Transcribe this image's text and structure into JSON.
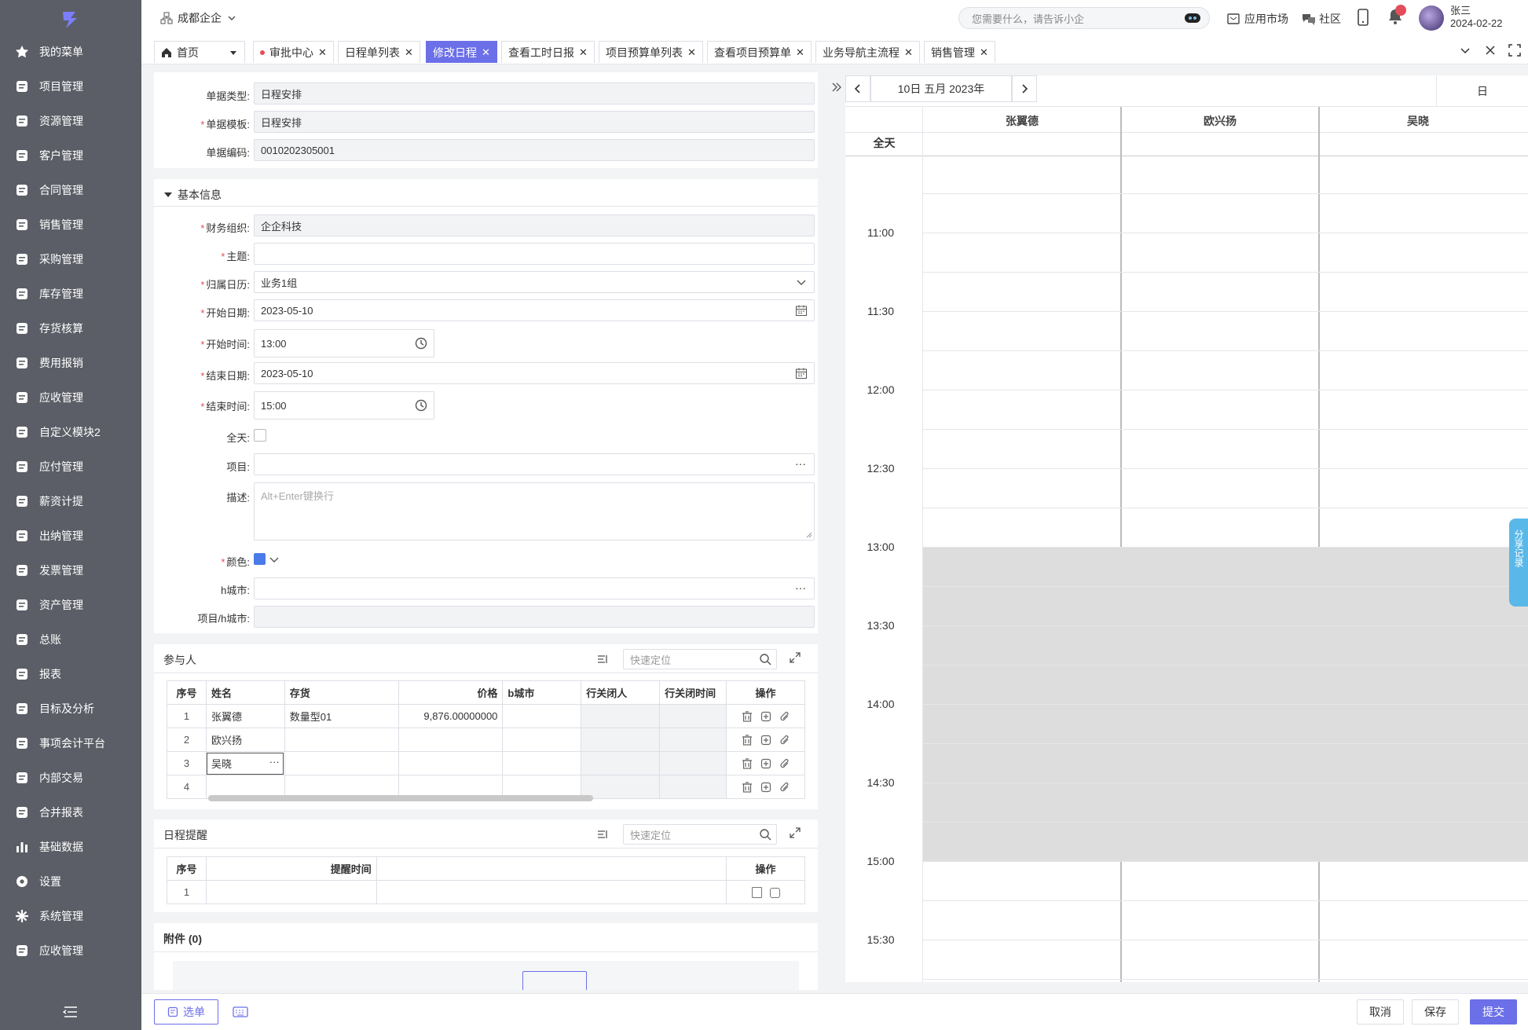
{
  "sidebar": {
    "items": [
      {
        "label": "我的菜单",
        "icon": "star-icon"
      },
      {
        "label": "项目管理",
        "icon": "project-icon"
      },
      {
        "label": "资源管理",
        "icon": "layers-icon"
      },
      {
        "label": "客户管理",
        "icon": "customer-icon"
      },
      {
        "label": "合同管理",
        "icon": "contract-icon"
      },
      {
        "label": "销售管理",
        "icon": "sales-icon"
      },
      {
        "label": "采购管理",
        "icon": "cart-icon"
      },
      {
        "label": "库存管理",
        "icon": "warehouse-icon"
      },
      {
        "label": "存货核算",
        "icon": "inventory-icon"
      },
      {
        "label": "费用报销",
        "icon": "expense-icon"
      },
      {
        "label": "应收管理",
        "icon": "receivable-icon"
      },
      {
        "label": "自定义模块2",
        "icon": "chart-line-icon"
      },
      {
        "label": "应付管理",
        "icon": "payable-icon"
      },
      {
        "label": "薪资计提",
        "icon": "salary-icon"
      },
      {
        "label": "出纳管理",
        "icon": "cashier-icon"
      },
      {
        "label": "发票管理",
        "icon": "invoice-icon"
      },
      {
        "label": "资产管理",
        "icon": "asset-icon"
      },
      {
        "label": "总账",
        "icon": "ledger-icon"
      },
      {
        "label": "报表",
        "icon": "report-icon"
      },
      {
        "label": "目标及分析",
        "icon": "target-icon"
      },
      {
        "label": "事项会计平台",
        "icon": "grid-icon"
      },
      {
        "label": "内部交易",
        "icon": "exchange-icon"
      },
      {
        "label": "合并报表",
        "icon": "merge-report-icon"
      },
      {
        "label": "基础数据",
        "icon": "bar-chart-icon"
      },
      {
        "label": "设置",
        "icon": "gear-icon"
      },
      {
        "label": "系统管理",
        "icon": "system-icon"
      },
      {
        "label": "应收管理",
        "icon": "receivable-icon"
      }
    ]
  },
  "header": {
    "org": "成都企企",
    "search_placeholder": "您需要什么，请告诉小企",
    "app_market": "应用市场",
    "community": "社区",
    "user_name": "张三",
    "date": "2024-02-22"
  },
  "tabs": [
    {
      "label": "首页"
    },
    {
      "label": "审批中心"
    },
    {
      "label": "日程单列表"
    },
    {
      "label": "修改日程"
    },
    {
      "label": "查看工时日报"
    },
    {
      "label": "项目预算单列表"
    },
    {
      "label": "查看项目预算单"
    },
    {
      "label": "业务导航主流程"
    },
    {
      "label": "销售管理"
    }
  ],
  "form": {
    "doc_type_label": "单据类型:",
    "doc_type_value": "日程安排",
    "template_label": "单据模板:",
    "template_value": "日程安排",
    "code_label": "单据编码:",
    "code_value": "0010202305001",
    "section_basic": "基本信息",
    "org_label": "财务组织:",
    "org_value": "企企科技",
    "subject_label": "主题:",
    "subject_value": "",
    "calendar_label": "归属日历:",
    "calendar_value": "业务1组",
    "start_date_label": "开始日期:",
    "start_date_value": "2023-05-10",
    "start_time_label": "开始时间:",
    "start_time_value": "13:00",
    "end_date_label": "结束日期:",
    "end_date_value": "2023-05-10",
    "end_time_label": "结束时间:",
    "end_time_value": "15:00",
    "allday_label": "全天:",
    "project_label": "项目:",
    "desc_label": "描述:",
    "desc_placeholder": "Alt+Enter键换行",
    "color_label": "颜色:",
    "color_value": "#4a7be8",
    "hcity_label": "h城市:",
    "project_hcity_label": "项目/h城市:"
  },
  "participants": {
    "title": "参与人",
    "search_placeholder": "快速定位",
    "headers": [
      "序号",
      "姓名",
      "存货",
      "价格",
      "b城市",
      "行关闭人",
      "行关闭时间",
      "操作"
    ],
    "rows": [
      {
        "no": "1",
        "name": "张翼德",
        "stock": "数量型01",
        "price": "9,876.00000000"
      },
      {
        "no": "2",
        "name": "欧兴扬",
        "stock": "",
        "price": ""
      },
      {
        "no": "3",
        "name": "吴晓",
        "stock": "",
        "price": ""
      },
      {
        "no": "4",
        "name": "",
        "stock": "",
        "price": ""
      }
    ]
  },
  "reminders": {
    "title": "日程提醒",
    "search_placeholder": "快速定位",
    "headers": [
      "序号",
      "提醒时间",
      "",
      "操作"
    ],
    "rows": [
      {
        "no": "1"
      }
    ]
  },
  "attachments": {
    "title": "附件 (0)"
  },
  "calendar": {
    "date_label": "10日 五月 2023年",
    "view_label": "日",
    "allday_label": "全天",
    "people": [
      "张翼德",
      "欧兴扬",
      "吴晓"
    ],
    "times": [
      "11:00",
      "11:30",
      "12:00",
      "12:30",
      "13:00",
      "13:30",
      "14:00",
      "14:30",
      "15:00",
      "15:30"
    ],
    "event_start": "13:00",
    "event_end": "15:00",
    "share_label": "分享记录"
  },
  "footer": {
    "menu_label": "选单",
    "cancel": "取消",
    "save": "保存",
    "submit": "提交"
  },
  "colors": {
    "accent": "#6b6fe8",
    "sidebar": "#5b5e66",
    "event": "#dddddd"
  }
}
